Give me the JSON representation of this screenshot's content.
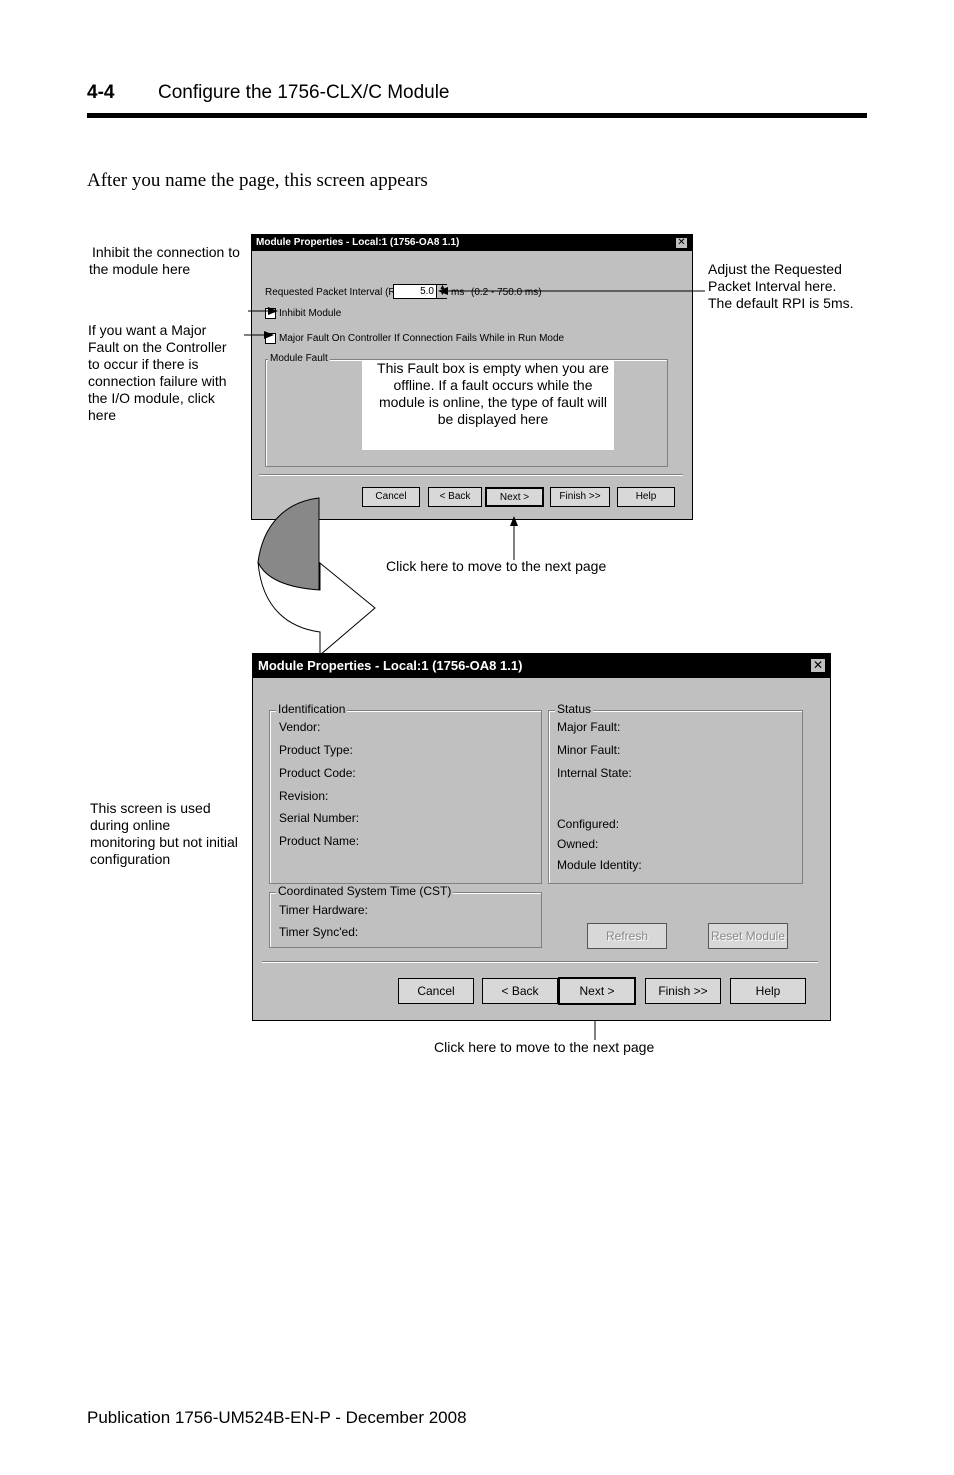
{
  "header": {
    "section_number": "4-4",
    "title": "Configure the 1756-CLX/C Module"
  },
  "intro": "After you name the page, this screen appears",
  "callouts": {
    "inhibit_line1": "Inhibit the connection to",
    "inhibit_line2": "the module here",
    "rpi_line1": "Adjust the Requested",
    "rpi_line2": "Packet Interval here.",
    "rpi_line3": "The default RPI is 5ms.",
    "major_line1": "If you want a Major",
    "major_line2": "Fault on the Controller",
    "major_line3": "to occur if there is",
    "major_line4": "connection failure with",
    "major_line5": "the I/O module, click",
    "major_line6": "here",
    "fault_line1": "This Fault box is empty when you are",
    "fault_line2": "offline. If a fault occurs while the",
    "fault_line3": "module is online, the type of fault will",
    "fault_line4": "be displayed here",
    "next1": "Click here to move to the next page",
    "online_line1": "This screen is used",
    "online_line2": "during online",
    "online_line3": "monitoring but not initial",
    "online_line4": "configuration",
    "next2": "Click here to move to the next page"
  },
  "dialog1": {
    "title": "Module Properties - Local:1 (1756-OA8 1.1)",
    "close": "✕",
    "rpi_label": "Requested Packet Interval (RPI):",
    "rpi_value": "5.0",
    "rpi_unit": "ms",
    "rpi_range": "(0.2 - 750.0 ms)",
    "inhibit_label": "Inhibit Module",
    "major_fault_label": "Major Fault On Controller If Connection Fails While in Run Mode",
    "module_fault_legend": "Module Fault",
    "buttons": {
      "cancel": "Cancel",
      "back": "< Back",
      "next": "Next >",
      "finish": "Finish >>",
      "help": "Help"
    }
  },
  "dialog2": {
    "title": "Module Properties - Local:1 (1756-OA8 1.1)",
    "close": "✕",
    "identification": {
      "legend": "Identification",
      "vendor": "Vendor:",
      "product_type": "Product Type:",
      "product_code": "Product Code:",
      "revision": "Revision:",
      "serial_number": "Serial Number:",
      "product_name": "Product Name:"
    },
    "status": {
      "legend": "Status",
      "major_fault": "Major Fault:",
      "minor_fault": "Minor Fault:",
      "internal_state": "Internal State:",
      "configured": "Configured:",
      "owned": "Owned:",
      "module_identity": "Module Identity:"
    },
    "cst": {
      "legend": "Coordinated System Time (CST)",
      "timer_hardware": "Timer Hardware:",
      "timer_synced": "Timer Sync'ed:"
    },
    "refresh": "Refresh",
    "reset_module": "Reset Module",
    "buttons": {
      "cancel": "Cancel",
      "back": "< Back",
      "next": "Next >",
      "finish": "Finish >>",
      "help": "Help"
    }
  },
  "footer": "Publication 1756-UM524B-EN-P - December 2008"
}
